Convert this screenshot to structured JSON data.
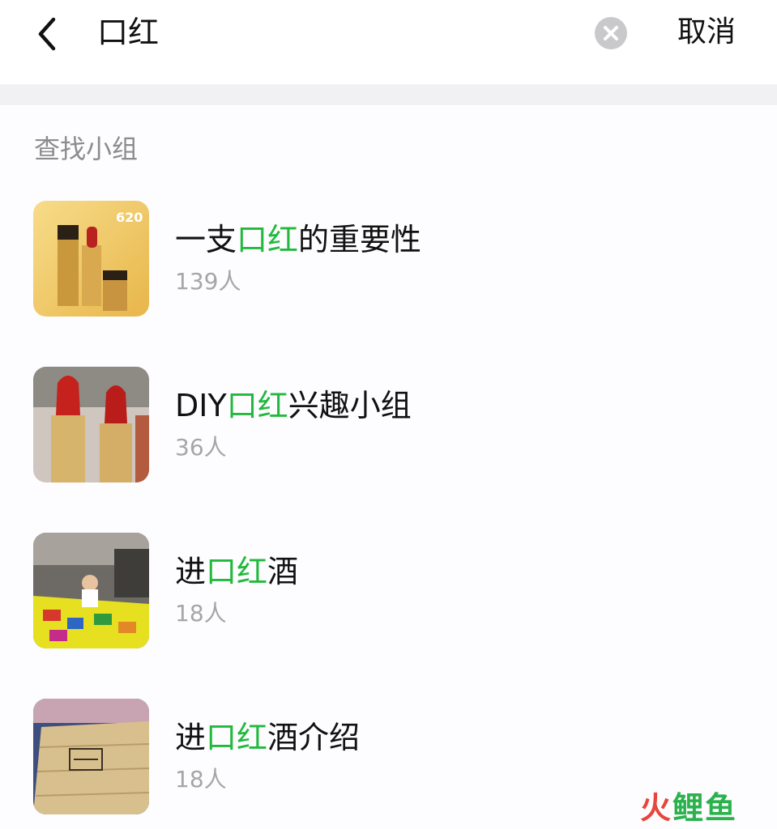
{
  "header": {
    "search_value": "口红",
    "cancel_label": "取消"
  },
  "section": {
    "title": "查找小组"
  },
  "groups": [
    {
      "name_before": "一支",
      "name_match": "口红",
      "name_after": "的重要性",
      "members": "139人",
      "thumb_icon": "lipstick-gold-box-image"
    },
    {
      "name_before": "DIY",
      "name_match": "口红",
      "name_after": "兴趣小组",
      "members": "36人",
      "thumb_icon": "red-lipsticks-image"
    },
    {
      "name_before": "进",
      "name_match": "口红",
      "name_after": "酒",
      "members": "18人",
      "thumb_icon": "child-playroom-image"
    },
    {
      "name_before": "进",
      "name_match": "口红",
      "name_after": "酒介绍",
      "members": "18人",
      "thumb_icon": "wooden-box-image"
    }
  ],
  "watermark": {
    "text": "火鲤鱼"
  },
  "colors": {
    "highlight": "#22b93e",
    "muted_text": "#8c8c8c",
    "count_text": "#a6a6a6",
    "band": "#f1f1f3",
    "watermark_red": "#e8453c",
    "watermark_green": "#2bb24c"
  }
}
